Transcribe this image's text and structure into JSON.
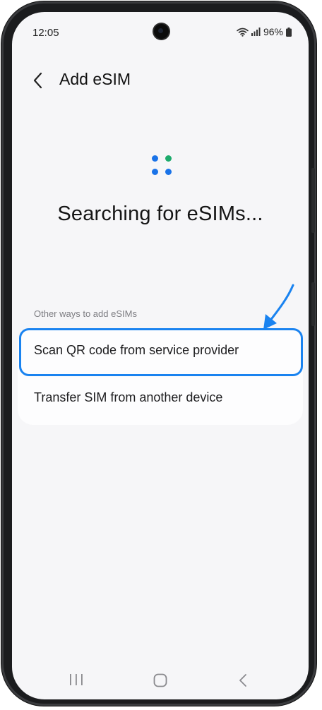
{
  "status_bar": {
    "time": "12:05",
    "battery": "96%"
  },
  "header": {
    "title": "Add eSIM",
    "back_icon": "chevron-left-icon"
  },
  "loading": {
    "colors": [
      "#1a73e8",
      "#1dab6c",
      "#1a73e8",
      "#1a73e8"
    ]
  },
  "main": {
    "status_text": "Searching for eSIMs...",
    "section_label": "Other ways to add eSIMs",
    "options": [
      {
        "label": "Scan QR code from service provider"
      },
      {
        "label": "Transfer SIM from another device"
      }
    ]
  },
  "annotation": {
    "color": "#1a83f0"
  },
  "nav_bar": {
    "icons": [
      "recents-icon",
      "home-icon",
      "back-icon"
    ]
  }
}
